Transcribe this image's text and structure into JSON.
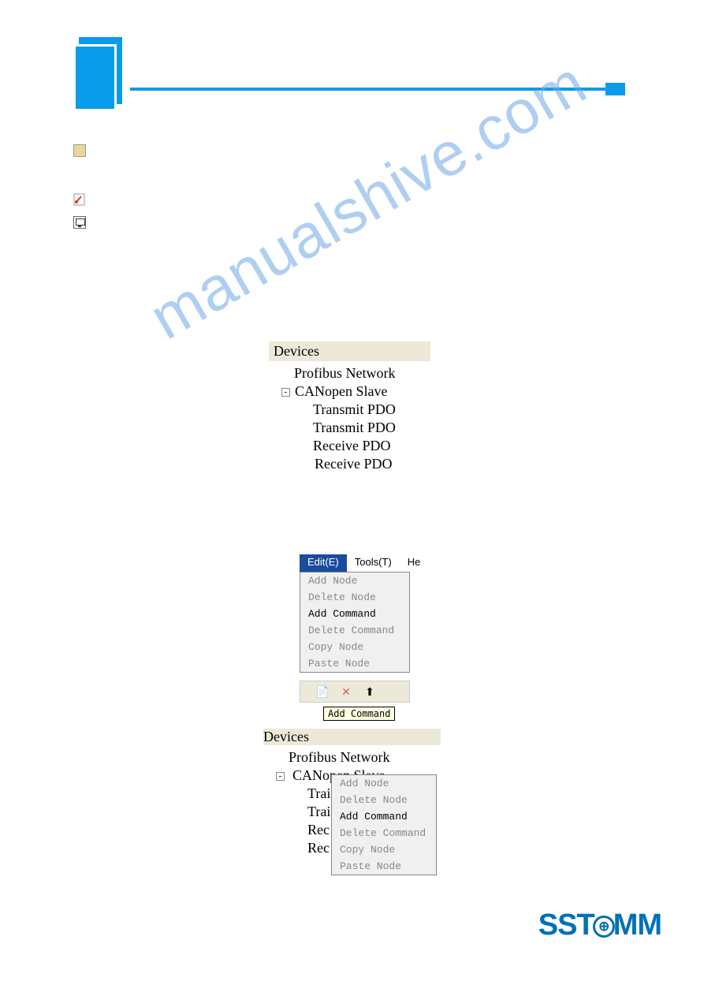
{
  "devices_title": "Devices",
  "tree": {
    "profibus": "Profibus Network",
    "canopen": "CANopen Slave",
    "tpdo": "Transmit PDO",
    "rpdo": "Receive PDO"
  },
  "edit_menu_label": "Edit(E)",
  "tools_menu_label": "Tools(T)",
  "help_stub": "He",
  "menu": {
    "add_node": "Add Node",
    "delete_node": "Delete Node",
    "add_command": "Add Command",
    "delete_command": "Delete Command",
    "copy_node": "Copy Node",
    "paste_node": "Paste Node"
  },
  "tooltip_add_command": "Add Command",
  "panelB_rows": {
    "r1": "Trai",
    "r2": "Trai",
    "r3": "Rec",
    "r4": "Rec"
  },
  "watermark": "manualshive.com",
  "logo": {
    "p1": "SST",
    "p2": "MM"
  }
}
